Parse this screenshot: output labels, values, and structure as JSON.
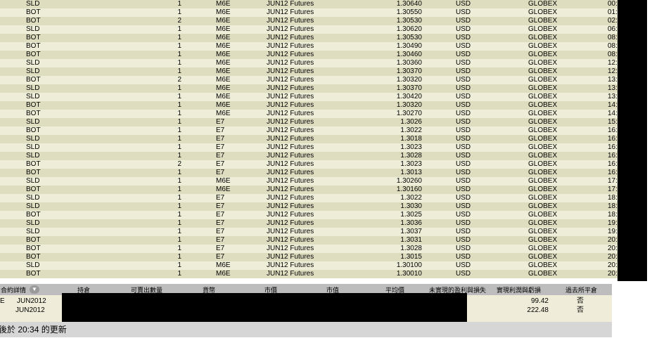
{
  "trades": [
    {
      "action": "SLD",
      "qty": "1",
      "symbol": "M6E",
      "expiry": "JUN12 Futures",
      "price": "1.30640",
      "currency": "USD",
      "exchange": "GLOBEX",
      "time": "00:"
    },
    {
      "action": "BOT",
      "qty": "1",
      "symbol": "M6E",
      "expiry": "JUN12 Futures",
      "price": "1.30550",
      "currency": "USD",
      "exchange": "GLOBEX",
      "time": "01:"
    },
    {
      "action": "BOT",
      "qty": "2",
      "symbol": "M6E",
      "expiry": "JUN12 Futures",
      "price": "1.30530",
      "currency": "USD",
      "exchange": "GLOBEX",
      "time": "02:"
    },
    {
      "action": "SLD",
      "qty": "1",
      "symbol": "M6E",
      "expiry": "JUN12 Futures",
      "price": "1.30620",
      "currency": "USD",
      "exchange": "GLOBEX",
      "time": "06:"
    },
    {
      "action": "BOT",
      "qty": "1",
      "symbol": "M6E",
      "expiry": "JUN12 Futures",
      "price": "1.30530",
      "currency": "USD",
      "exchange": "GLOBEX",
      "time": "08:"
    },
    {
      "action": "BOT",
      "qty": "1",
      "symbol": "M6E",
      "expiry": "JUN12 Futures",
      "price": "1.30490",
      "currency": "USD",
      "exchange": "GLOBEX",
      "time": "08:"
    },
    {
      "action": "BOT",
      "qty": "1",
      "symbol": "M6E",
      "expiry": "JUN12 Futures",
      "price": "1.30460",
      "currency": "USD",
      "exchange": "GLOBEX",
      "time": "08:"
    },
    {
      "action": "SLD",
      "qty": "1",
      "symbol": "M6E",
      "expiry": "JUN12 Futures",
      "price": "1.30360",
      "currency": "USD",
      "exchange": "GLOBEX",
      "time": "12:"
    },
    {
      "action": "SLD",
      "qty": "1",
      "symbol": "M6E",
      "expiry": "JUN12 Futures",
      "price": "1.30370",
      "currency": "USD",
      "exchange": "GLOBEX",
      "time": "12:"
    },
    {
      "action": "BOT",
      "qty": "2",
      "symbol": "M6E",
      "expiry": "JUN12 Futures",
      "price": "1.30320",
      "currency": "USD",
      "exchange": "GLOBEX",
      "time": "13:"
    },
    {
      "action": "SLD",
      "qty": "1",
      "symbol": "M6E",
      "expiry": "JUN12 Futures",
      "price": "1.30370",
      "currency": "USD",
      "exchange": "GLOBEX",
      "time": "13:"
    },
    {
      "action": "SLD",
      "qty": "1",
      "symbol": "M6E",
      "expiry": "JUN12 Futures",
      "price": "1.30420",
      "currency": "USD",
      "exchange": "GLOBEX",
      "time": "13:"
    },
    {
      "action": "BOT",
      "qty": "1",
      "symbol": "M6E",
      "expiry": "JUN12 Futures",
      "price": "1.30320",
      "currency": "USD",
      "exchange": "GLOBEX",
      "time": "14:"
    },
    {
      "action": "BOT",
      "qty": "1",
      "symbol": "M6E",
      "expiry": "JUN12 Futures",
      "price": "1.30270",
      "currency": "USD",
      "exchange": "GLOBEX",
      "time": "14:"
    },
    {
      "action": "SLD",
      "qty": "1",
      "symbol": "E7",
      "expiry": "JUN12 Futures",
      "price": "1.3026",
      "currency": "USD",
      "exchange": "GLOBEX",
      "time": "15:"
    },
    {
      "action": "BOT",
      "qty": "1",
      "symbol": "E7",
      "expiry": "JUN12 Futures",
      "price": "1.3022",
      "currency": "USD",
      "exchange": "GLOBEX",
      "time": "16:"
    },
    {
      "action": "SLD",
      "qty": "1",
      "symbol": "E7",
      "expiry": "JUN12 Futures",
      "price": "1.3018",
      "currency": "USD",
      "exchange": "GLOBEX",
      "time": "16:"
    },
    {
      "action": "SLD",
      "qty": "1",
      "symbol": "E7",
      "expiry": "JUN12 Futures",
      "price": "1.3023",
      "currency": "USD",
      "exchange": "GLOBEX",
      "time": "16:"
    },
    {
      "action": "SLD",
      "qty": "1",
      "symbol": "E7",
      "expiry": "JUN12 Futures",
      "price": "1.3028",
      "currency": "USD",
      "exchange": "GLOBEX",
      "time": "16:"
    },
    {
      "action": "BOT",
      "qty": "2",
      "symbol": "E7",
      "expiry": "JUN12 Futures",
      "price": "1.3023",
      "currency": "USD",
      "exchange": "GLOBEX",
      "time": "16:"
    },
    {
      "action": "BOT",
      "qty": "1",
      "symbol": "E7",
      "expiry": "JUN12 Futures",
      "price": "1.3013",
      "currency": "USD",
      "exchange": "GLOBEX",
      "time": "16:"
    },
    {
      "action": "SLD",
      "qty": "1",
      "symbol": "M6E",
      "expiry": "JUN12 Futures",
      "price": "1.30260",
      "currency": "USD",
      "exchange": "GLOBEX",
      "time": "17:"
    },
    {
      "action": "BOT",
      "qty": "1",
      "symbol": "M6E",
      "expiry": "JUN12 Futures",
      "price": "1.30160",
      "currency": "USD",
      "exchange": "GLOBEX",
      "time": "17:"
    },
    {
      "action": "SLD",
      "qty": "1",
      "symbol": "E7",
      "expiry": "JUN12 Futures",
      "price": "1.3022",
      "currency": "USD",
      "exchange": "GLOBEX",
      "time": "18:"
    },
    {
      "action": "SLD",
      "qty": "1",
      "symbol": "E7",
      "expiry": "JUN12 Futures",
      "price": "1.3030",
      "currency": "USD",
      "exchange": "GLOBEX",
      "time": "18:"
    },
    {
      "action": "BOT",
      "qty": "1",
      "symbol": "E7",
      "expiry": "JUN12 Futures",
      "price": "1.3025",
      "currency": "USD",
      "exchange": "GLOBEX",
      "time": "18:"
    },
    {
      "action": "SLD",
      "qty": "1",
      "symbol": "E7",
      "expiry": "JUN12 Futures",
      "price": "1.3036",
      "currency": "USD",
      "exchange": "GLOBEX",
      "time": "19:"
    },
    {
      "action": "SLD",
      "qty": "1",
      "symbol": "E7",
      "expiry": "JUN12 Futures",
      "price": "1.3037",
      "currency": "USD",
      "exchange": "GLOBEX",
      "time": "19:"
    },
    {
      "action": "BOT",
      "qty": "1",
      "symbol": "E7",
      "expiry": "JUN12 Futures",
      "price": "1.3031",
      "currency": "USD",
      "exchange": "GLOBEX",
      "time": "20:"
    },
    {
      "action": "BOT",
      "qty": "1",
      "symbol": "E7",
      "expiry": "JUN12 Futures",
      "price": "1.3028",
      "currency": "USD",
      "exchange": "GLOBEX",
      "time": "20:"
    },
    {
      "action": "BOT",
      "qty": "1",
      "symbol": "E7",
      "expiry": "JUN12 Futures",
      "price": "1.3015",
      "currency": "USD",
      "exchange": "GLOBEX",
      "time": "20:"
    },
    {
      "action": "SLD",
      "qty": "1",
      "symbol": "M6E",
      "expiry": "JUN12 Futures",
      "price": "1.30100",
      "currency": "USD",
      "exchange": "GLOBEX",
      "time": "20:"
    },
    {
      "action": "BOT",
      "qty": "1",
      "symbol": "M6E",
      "expiry": "JUN12 Futures",
      "price": "1.30010",
      "currency": "USD",
      "exchange": "GLOBEX",
      "time": "20:"
    }
  ],
  "positions": {
    "headers": {
      "contract": "合約詳情",
      "position": "持倉",
      "salable": "可賣出數量",
      "currency": "貨幣",
      "market_price": "市價",
      "market_value": "市值",
      "avg_price": "平均價",
      "unrealized": "未實現的盈利與損失",
      "realized": "實現利潤與虧損",
      "closed": "過去所平倉"
    },
    "sort_icon": "sort-down-icon",
    "rows": [
      {
        "prefix": "E",
        "contract": "JUN2012",
        "realized": "99.42",
        "closed": "否"
      },
      {
        "prefix": "",
        "contract": "JUN2012",
        "realized": "222.48",
        "closed": "否"
      }
    ]
  },
  "status": {
    "text": "後於 20:34 的更新"
  },
  "colors": {
    "row_odd": "#dfddc0",
    "row_even": "#eeedd8",
    "header_bg": "#bdbdbd",
    "status_bg": "#d6d6d6",
    "redaction": "#000000"
  }
}
